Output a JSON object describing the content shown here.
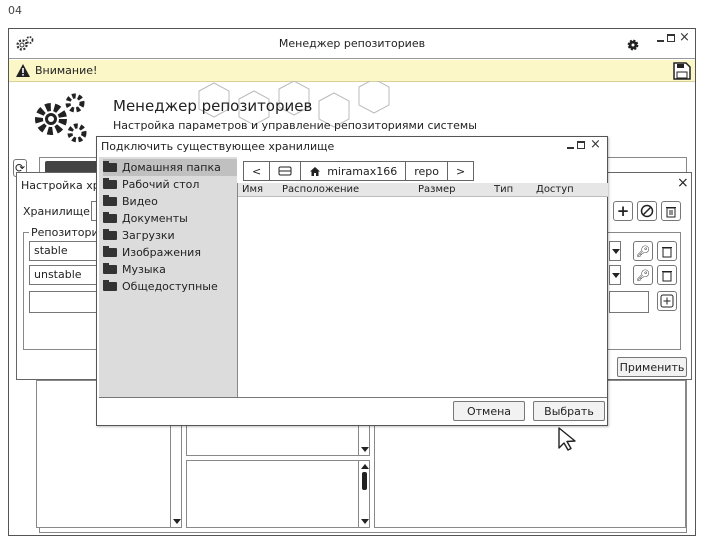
{
  "frame_number": "04",
  "window": {
    "title": "Менеджер репозиториев",
    "warning": "Внимание!",
    "header_title": "Менеджер репозиториев",
    "header_subtitle": "Настройка параметров и управление репозиториями системы"
  },
  "settings_dialog": {
    "title": "Настройка хра",
    "storage_label": "Хранилище:",
    "repos_label": "Репозитори",
    "repos": [
      "stable",
      "unstable",
      ""
    ],
    "apply_label": "Применить"
  },
  "connect_dialog": {
    "title": "Подключить существующее хранилище",
    "sidebar": [
      "Домашняя папка",
      "Рабочий стол",
      "Видео",
      "Документы",
      "Загрузки",
      "Изображения",
      "Музыка",
      "Общедоступные"
    ],
    "selected_index": 0,
    "crumbs": {
      "back": "<",
      "user": "miramax166",
      "repo": "repo",
      "forward": ">"
    },
    "columns": [
      "Имя",
      "Расположение",
      "Размер",
      "Тип",
      "Доступ"
    ],
    "cancel_label": "Отмена",
    "select_label": "Выбрать"
  },
  "icons": [
    "gears-icon",
    "gear-icon",
    "warning-icon",
    "save-icon",
    "folder-icon",
    "home-icon",
    "drive-icon",
    "plus-icon",
    "cancel-icon",
    "trash-icon",
    "key-icon",
    "add-box-icon",
    "refresh-icon",
    "cursor-icon"
  ]
}
